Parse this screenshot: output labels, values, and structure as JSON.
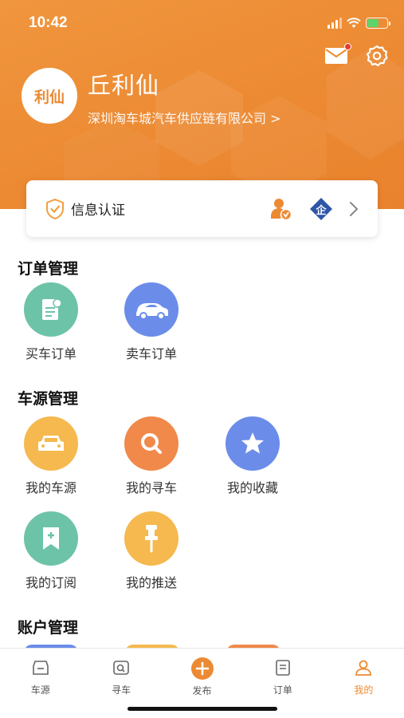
{
  "status_bar": {
    "time": "10:42"
  },
  "profile": {
    "avatar_text": "利仙",
    "name": "丘利仙",
    "company": "深圳淘车城汽车供应链有限公司 >"
  },
  "certification": {
    "label": "信息认证",
    "badge_enterprise": "企"
  },
  "sections": {
    "orders": {
      "title": "订单管理",
      "items": [
        {
          "label": "买车订单",
          "icon": "document-icon",
          "color": "#6cc3a8"
        },
        {
          "label": "卖车订单",
          "icon": "car-icon",
          "color": "#6b8de9"
        }
      ]
    },
    "vehicles": {
      "title": "车源管理",
      "items": [
        {
          "label": "我的车源",
          "icon": "car-front-icon",
          "color": "#f5b94f"
        },
        {
          "label": "我的寻车",
          "icon": "search-icon",
          "color": "#f0894a"
        },
        {
          "label": "我的收藏",
          "icon": "star-icon",
          "color": "#6b8de9"
        },
        {
          "label": "我的订阅",
          "icon": "bookmark-icon",
          "color": "#6cc3a8"
        },
        {
          "label": "我的推送",
          "icon": "pin-icon",
          "color": "#f5b94f"
        }
      ]
    },
    "account": {
      "title": "账户管理"
    }
  },
  "tabbar": [
    {
      "label": "车源",
      "icon": "car-tab-icon",
      "active": false
    },
    {
      "label": "寻车",
      "icon": "search-tab-icon",
      "active": false
    },
    {
      "label": "发布",
      "icon": "plus-icon",
      "active": false
    },
    {
      "label": "订单",
      "icon": "order-tab-icon",
      "active": false
    },
    {
      "label": "我的",
      "icon": "user-icon",
      "active": true
    }
  ],
  "colors": {
    "brand": "#ec8a33",
    "green": "#6cc3a8",
    "blue": "#6b8de9",
    "yellow": "#f5b94f",
    "orange": "#f0894a"
  }
}
